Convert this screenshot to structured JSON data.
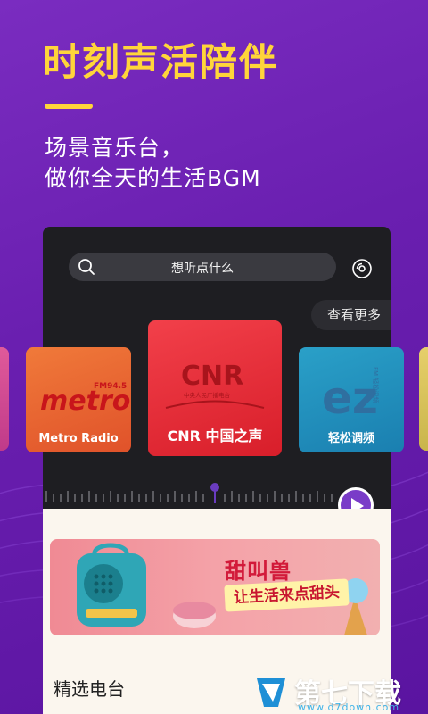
{
  "promo": {
    "headline": "时刻声活陪伴",
    "subline_1": "场景音乐台，",
    "subline_2": "做你全天的生活BGM"
  },
  "search": {
    "placeholder": "想听点什么"
  },
  "more_label": "查看更多",
  "stations": [
    {
      "name": "Metro Radio",
      "logo_text": "metro",
      "badge": "FM94.5"
    },
    {
      "name": "CNR 中国之声",
      "logo_text": "CNR",
      "logo_sub": "中央人民广播电台"
    },
    {
      "name": "轻松调频",
      "logo_text": "ez",
      "logo_side": "FM 轻松调频"
    }
  ],
  "banner": {
    "title": "甜叫兽",
    "subtitle": "让生活来点甜头"
  },
  "section": {
    "title": "精选电台"
  },
  "watermark": {
    "name": "第七下载站",
    "url": "www.d7down.com"
  },
  "colors": {
    "headline": "#ffd53a",
    "background": "#6a1fb0",
    "accent": "#7a3cc8"
  }
}
